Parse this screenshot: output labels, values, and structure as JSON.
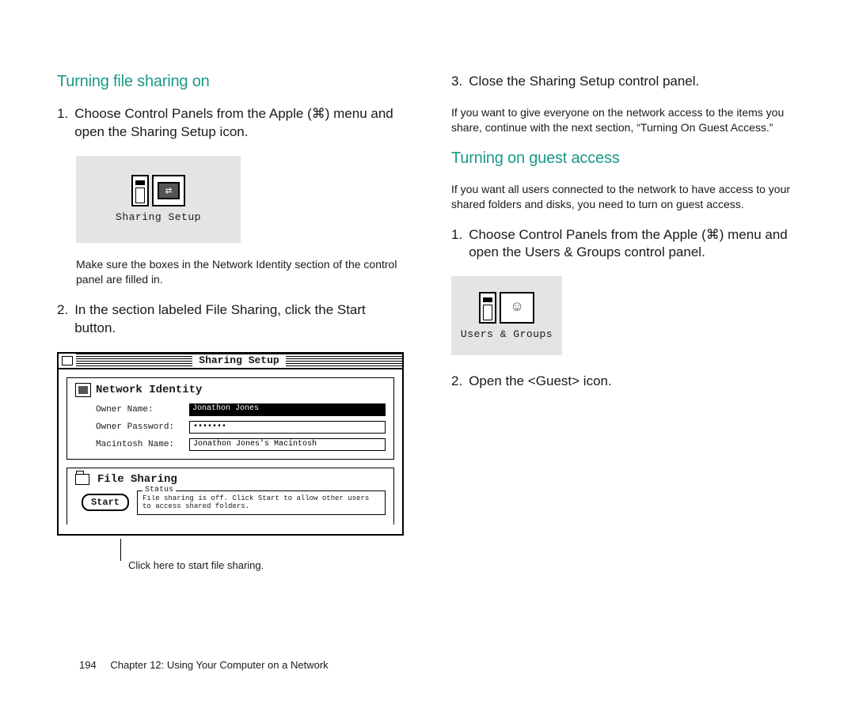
{
  "left": {
    "heading": "Turning file sharing on",
    "steps": {
      "s1_num": "1.",
      "s1_text": "Choose Control Panels from the Apple (⌘) menu and open the Sharing Setup icon.",
      "s2_num": "2.",
      "s2_text": "In the section labeled File Sharing, click the Start button."
    },
    "note1": "Make sure the boxes in the Network Identity section of the control panel are filled in.",
    "sharing_setup_label": "Sharing Setup",
    "callout": "Click here to start file sharing.",
    "window": {
      "title": "Sharing Setup",
      "network_identity_title": "Network Identity",
      "owner_name_label": "Owner Name:",
      "owner_name_value": "Jonathon Jones",
      "owner_password_label": "Owner Password:",
      "owner_password_value": "•••••••",
      "mac_name_label": "Macintosh Name:",
      "mac_name_value": "Jonathon Jones's Macintosh",
      "file_sharing_title": "File Sharing",
      "start_label": "Start",
      "status_legend": "Status",
      "status_text": "File sharing is off. Click Start to allow other users to access shared folders."
    }
  },
  "right": {
    "s3_num": "3.",
    "s3_text": "Close the Sharing Setup control panel.",
    "para1": "If you want to give everyone on the network access to the items you share, continue with the next section, “Turning On Guest Access.”",
    "heading2": "Turning on guest access",
    "para2": "If you want all users connected to the network to have access to your shared folders and disks, you need to turn on guest access.",
    "s1_num": "1.",
    "s1_text": "Choose Control Panels from the Apple (⌘) menu and open the Users & Groups control panel.",
    "users_groups_label": "Users & Groups",
    "s2_num": "2.",
    "s2_text": "Open the <Guest> icon."
  },
  "footer": {
    "page_number": "194",
    "chapter": "Chapter 12: Using Your Computer on a Network"
  }
}
